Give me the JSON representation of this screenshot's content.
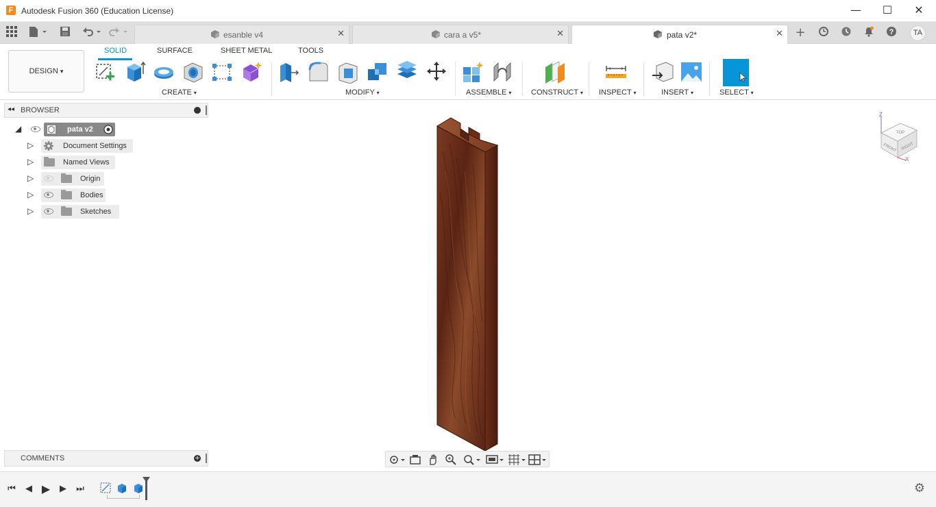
{
  "window": {
    "logo_letter": "F",
    "title": "Autodesk Fusion 360 (Education License)",
    "minimize": "—",
    "maximize": "☐",
    "close": "✕"
  },
  "tabs": [
    {
      "label": "esanble v4",
      "active": false
    },
    {
      "label": "cara a v5*",
      "active": false
    },
    {
      "label": "pata v2*",
      "active": true
    }
  ],
  "tab_close": "✕",
  "user": {
    "initials": "TA"
  },
  "ribbon": {
    "workspace": "DESIGN",
    "workspace_caret": "▾",
    "tabs": [
      "SOLID",
      "SURFACE",
      "SHEET METAL",
      "TOOLS"
    ],
    "groups": [
      "CREATE",
      "MODIFY",
      "ASSEMBLE",
      "CONSTRUCT",
      "INSPECT",
      "INSERT",
      "SELECT"
    ],
    "group_caret": "▾"
  },
  "browser": {
    "title": "BROWSER",
    "root": "pata v2",
    "items": [
      "Document Settings",
      "Named Views",
      "Origin",
      "Bodies",
      "Sketches"
    ]
  },
  "comments": {
    "title": "COMMENTS"
  },
  "viewcube": {
    "top": "TOP",
    "front": "FRONT",
    "right": "RIGHT",
    "axis_z": "Z",
    "axis_x": "X"
  },
  "colors": {
    "accent": "#0696d7",
    "select_tool": "#0696d7",
    "wood_dark": "#5a2414",
    "wood_mid": "#7a3a20",
    "wood_light": "#9a5634"
  }
}
